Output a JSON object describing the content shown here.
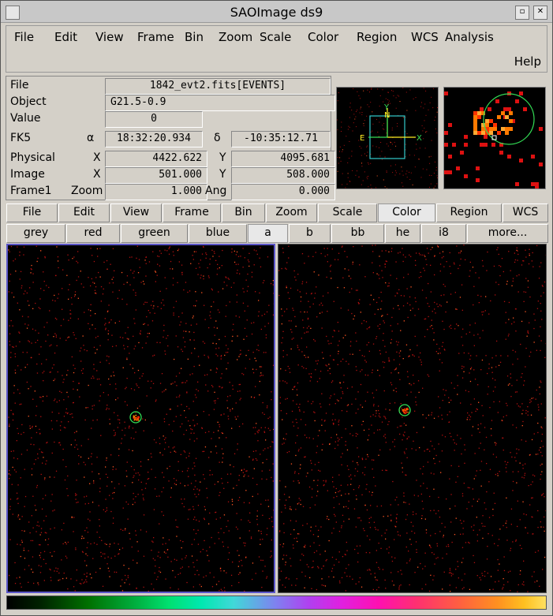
{
  "window": {
    "title": "SAOImage ds9"
  },
  "menubar": {
    "items": [
      "File",
      "Edit",
      "View",
      "Frame",
      "Bin",
      "Zoom",
      "Scale",
      "Color",
      "Region",
      "WCS",
      "Analysis"
    ],
    "help": "Help"
  },
  "info": {
    "file_label": "File",
    "file_value": "1842_evt2.fits[EVENTS]",
    "object_label": "Object",
    "object_value": "G21.5-0.9",
    "value_label": "Value",
    "value_value": "0",
    "fk5_label": "FK5",
    "alpha_symbol": "α",
    "alpha_value": "18:32:20.934",
    "delta_symbol": "δ",
    "delta_value": "-10:35:12.71",
    "physical_label": "Physical",
    "physical_x_label": "X",
    "physical_x": "4422.622",
    "physical_y_label": "Y",
    "physical_y": "4095.681",
    "image_label": "Image",
    "image_x_label": "X",
    "image_x": "501.000",
    "image_y_label": "Y",
    "image_y": "508.000",
    "frame_label": "Frame1",
    "zoom_label": "Zoom",
    "zoom_value": "1.000",
    "angle_label": "Ang",
    "angle_value": "0.000"
  },
  "panner": {
    "north": "N",
    "east": "E",
    "x_axis": "X",
    "y_axis": "Y"
  },
  "buttonbar": {
    "items": [
      "File",
      "Edit",
      "View",
      "Frame",
      "Bin",
      "Zoom",
      "Scale",
      "Color",
      "Region",
      "WCS"
    ],
    "active": "Color"
  },
  "colormaps": {
    "items": [
      "grey",
      "red",
      "green",
      "blue",
      "a",
      "b",
      "bb",
      "he",
      "i8",
      "more..."
    ],
    "active": "a"
  },
  "colors": {
    "frame_highlight": "#5a55c8",
    "region_circle": "#33dd55",
    "compass_cyan": "#33cccc",
    "compass_yellow": "#ffee22",
    "compass_green": "#33dd55"
  }
}
